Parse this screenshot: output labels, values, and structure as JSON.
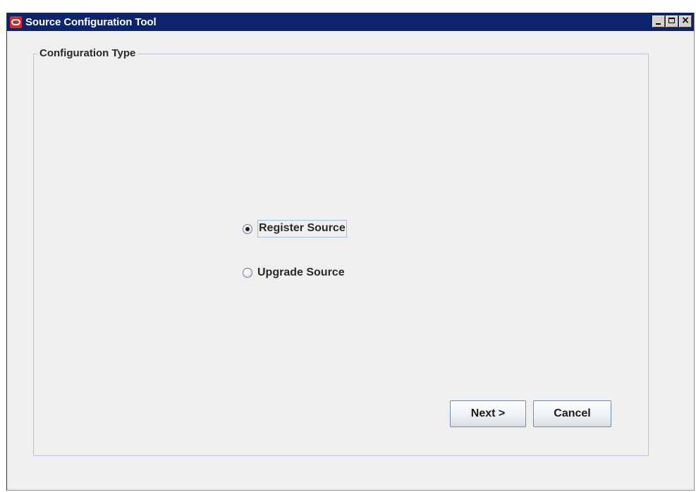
{
  "window": {
    "title": "Source Configuration Tool",
    "controls": {
      "minimize": "minimize-icon",
      "maximize": "maximize-icon",
      "close": "close-icon"
    },
    "title_bar_color": "#0c246a",
    "app_icon_color": "#d8262a"
  },
  "config_group": {
    "legend": "Configuration Type",
    "options": [
      {
        "label": "Register Source",
        "selected": true
      },
      {
        "label": "Upgrade Source",
        "selected": false
      }
    ]
  },
  "buttons": {
    "next_label": "Next >",
    "cancel_label": "Cancel"
  }
}
